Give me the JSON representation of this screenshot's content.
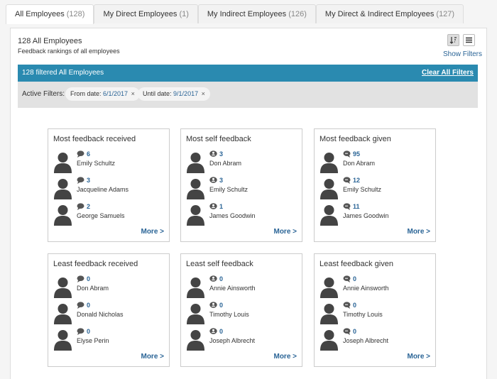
{
  "tabs": [
    {
      "label": "All Employees",
      "count": "(128)"
    },
    {
      "label": "My Direct Employees",
      "count": "(1)"
    },
    {
      "label": "My Indirect Employees",
      "count": "(126)"
    },
    {
      "label": "My Direct & Indirect Employees",
      "count": "(127)"
    }
  ],
  "header": {
    "title": "128 All Employees",
    "subtitle": "Feedback rankings of all employees",
    "show_filters": "Show Filters"
  },
  "filter_bar": {
    "label": "128 filtered All Employees",
    "clear": "Clear All Filters"
  },
  "active_filters": {
    "label": "Active Filters:",
    "chips": [
      {
        "prefix": "From date:",
        "value": "6/1/2017",
        "remove": "×"
      },
      {
        "prefix": "Until date:",
        "value": "9/1/2017",
        "remove": "×"
      }
    ]
  },
  "cards": [
    {
      "title": "Most feedback received",
      "icon": "speech-bubble-icon",
      "more": "More >",
      "rows": [
        {
          "value": "6",
          "name": "Emily Schultz"
        },
        {
          "value": "3",
          "name": "Jacqueline Adams"
        },
        {
          "value": "2",
          "name": "George Samuels"
        }
      ]
    },
    {
      "title": "Most self feedback",
      "icon": "self-feedback-icon",
      "more": "More >",
      "rows": [
        {
          "value": "3",
          "name": "Don Abram"
        },
        {
          "value": "3",
          "name": "Emily Schultz"
        },
        {
          "value": "1",
          "name": "James Goodwin"
        }
      ]
    },
    {
      "title": "Most feedback given",
      "icon": "speech-bubble-given-icon",
      "more": "More >",
      "rows": [
        {
          "value": "95",
          "name": "Don Abram"
        },
        {
          "value": "12",
          "name": "Emily Schultz"
        },
        {
          "value": "11",
          "name": "James Goodwin"
        }
      ]
    },
    {
      "title": "Least feedback received",
      "icon": "speech-bubble-icon",
      "more": "More >",
      "rows": [
        {
          "value": "0",
          "name": "Don Abram"
        },
        {
          "value": "0",
          "name": "Donald Nicholas"
        },
        {
          "value": "0",
          "name": "Elyse Perin"
        }
      ]
    },
    {
      "title": "Least self feedback",
      "icon": "self-feedback-icon",
      "more": "More >",
      "rows": [
        {
          "value": "0",
          "name": "Annie Ainsworth"
        },
        {
          "value": "0",
          "name": "Timothy Louis"
        },
        {
          "value": "0",
          "name": "Joseph Albrecht"
        }
      ]
    },
    {
      "title": "Least feedback given",
      "icon": "speech-bubble-given-icon",
      "more": "More >",
      "rows": [
        {
          "value": "0",
          "name": "Annie Ainsworth"
        },
        {
          "value": "0",
          "name": "Timothy Louis"
        },
        {
          "value": "0",
          "name": "Joseph Albrecht"
        }
      ]
    }
  ],
  "colors": {
    "accent": "#2a8ab0",
    "link": "#2a6496",
    "filter_bg": "#e2e2e2",
    "avatar": "#444444"
  }
}
